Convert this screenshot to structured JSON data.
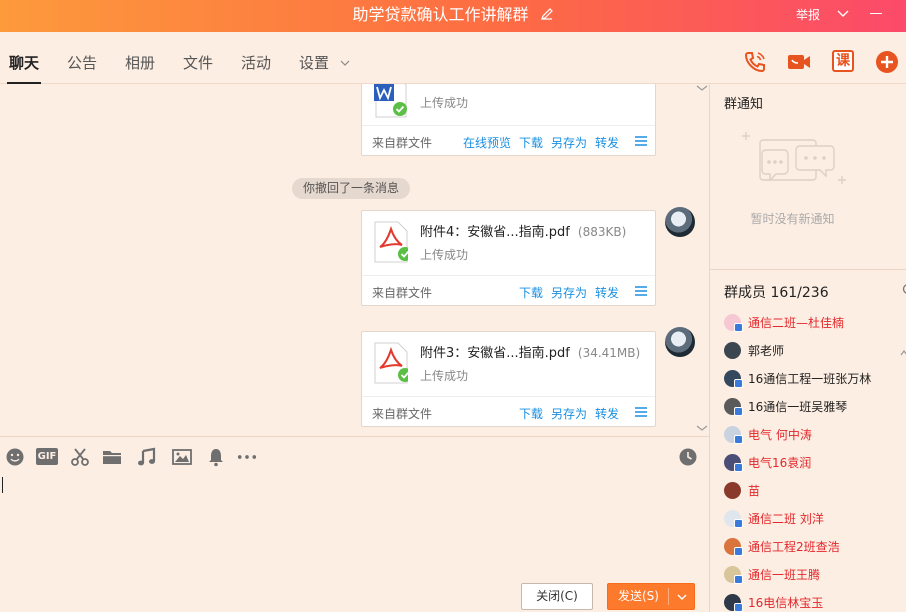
{
  "window": {
    "title": "助学贷款确认工作讲解群",
    "report_label": "举报"
  },
  "tabs": [
    {
      "label": "聊天",
      "active": true
    },
    {
      "label": "公告"
    },
    {
      "label": "相册"
    },
    {
      "label": "文件"
    },
    {
      "label": "活动"
    },
    {
      "label": "设置"
    }
  ],
  "toolbar_icons": [
    "phone-call-icon",
    "video-call-icon",
    "class-icon",
    "add-app-icon"
  ],
  "toolbar_class_label": "课",
  "messages": {
    "top_card": {
      "status": "上传成功",
      "source": "来自群文件",
      "actions": [
        "在线预览",
        "下载",
        "另存为",
        "转发"
      ],
      "file_type": "word"
    },
    "recall_notice": "你撤回了一条消息",
    "cards": [
      {
        "name": "附件4：安徽省...指南.pdf",
        "size": "(883KB)",
        "status": "上传成功",
        "source": "来自群文件",
        "actions": [
          "下载",
          "另存为",
          "转发"
        ],
        "file_type": "pdf"
      },
      {
        "name": "附件3：安徽省...指南.pdf",
        "size": "(34.41MB)",
        "status": "上传成功",
        "source": "来自群文件",
        "actions": [
          "下载",
          "另存为",
          "转发"
        ],
        "file_type": "pdf"
      }
    ]
  },
  "input_toolbar": [
    "emoji-icon",
    "gif-icon",
    "screenshot-scissors-icon",
    "folder-icon",
    "music-icon",
    "image-icon",
    "bell-icon",
    "more-icon",
    "history-clock-icon"
  ],
  "input_gif_label": "GIF",
  "buttons": {
    "close": "关闭(C)",
    "send": "发送(S)"
  },
  "notice": {
    "title": "群通知",
    "empty": "暂时没有新通知"
  },
  "members": {
    "title": "群成员 161/236",
    "list": [
      {
        "name": "通信二班—杜佳楠",
        "color": "#e3272b"
      },
      {
        "name": "郭老师",
        "color": "#222222"
      },
      {
        "name": "16通信工程一班张万林",
        "color": "#222222"
      },
      {
        "name": "16通信一班吴雅琴",
        "color": "#222222"
      },
      {
        "name": "电气 何中涛",
        "color": "#e3272b"
      },
      {
        "name": "电气16袁润",
        "color": "#e3272b"
      },
      {
        "name": "苗",
        "color": "#e3272b"
      },
      {
        "name": "通信二班 刘洋",
        "color": "#e3272b"
      },
      {
        "name": "通信工程2班查浩",
        "color": "#e3272b"
      },
      {
        "name": "通信一班王腾",
        "color": "#e3272b"
      },
      {
        "name": "16电信林宝玉",
        "color": "#e3272b"
      }
    ]
  },
  "colors": {
    "accent": "#fd7a2c",
    "link": "#1a8fe0",
    "member_red": "#e3272b"
  }
}
